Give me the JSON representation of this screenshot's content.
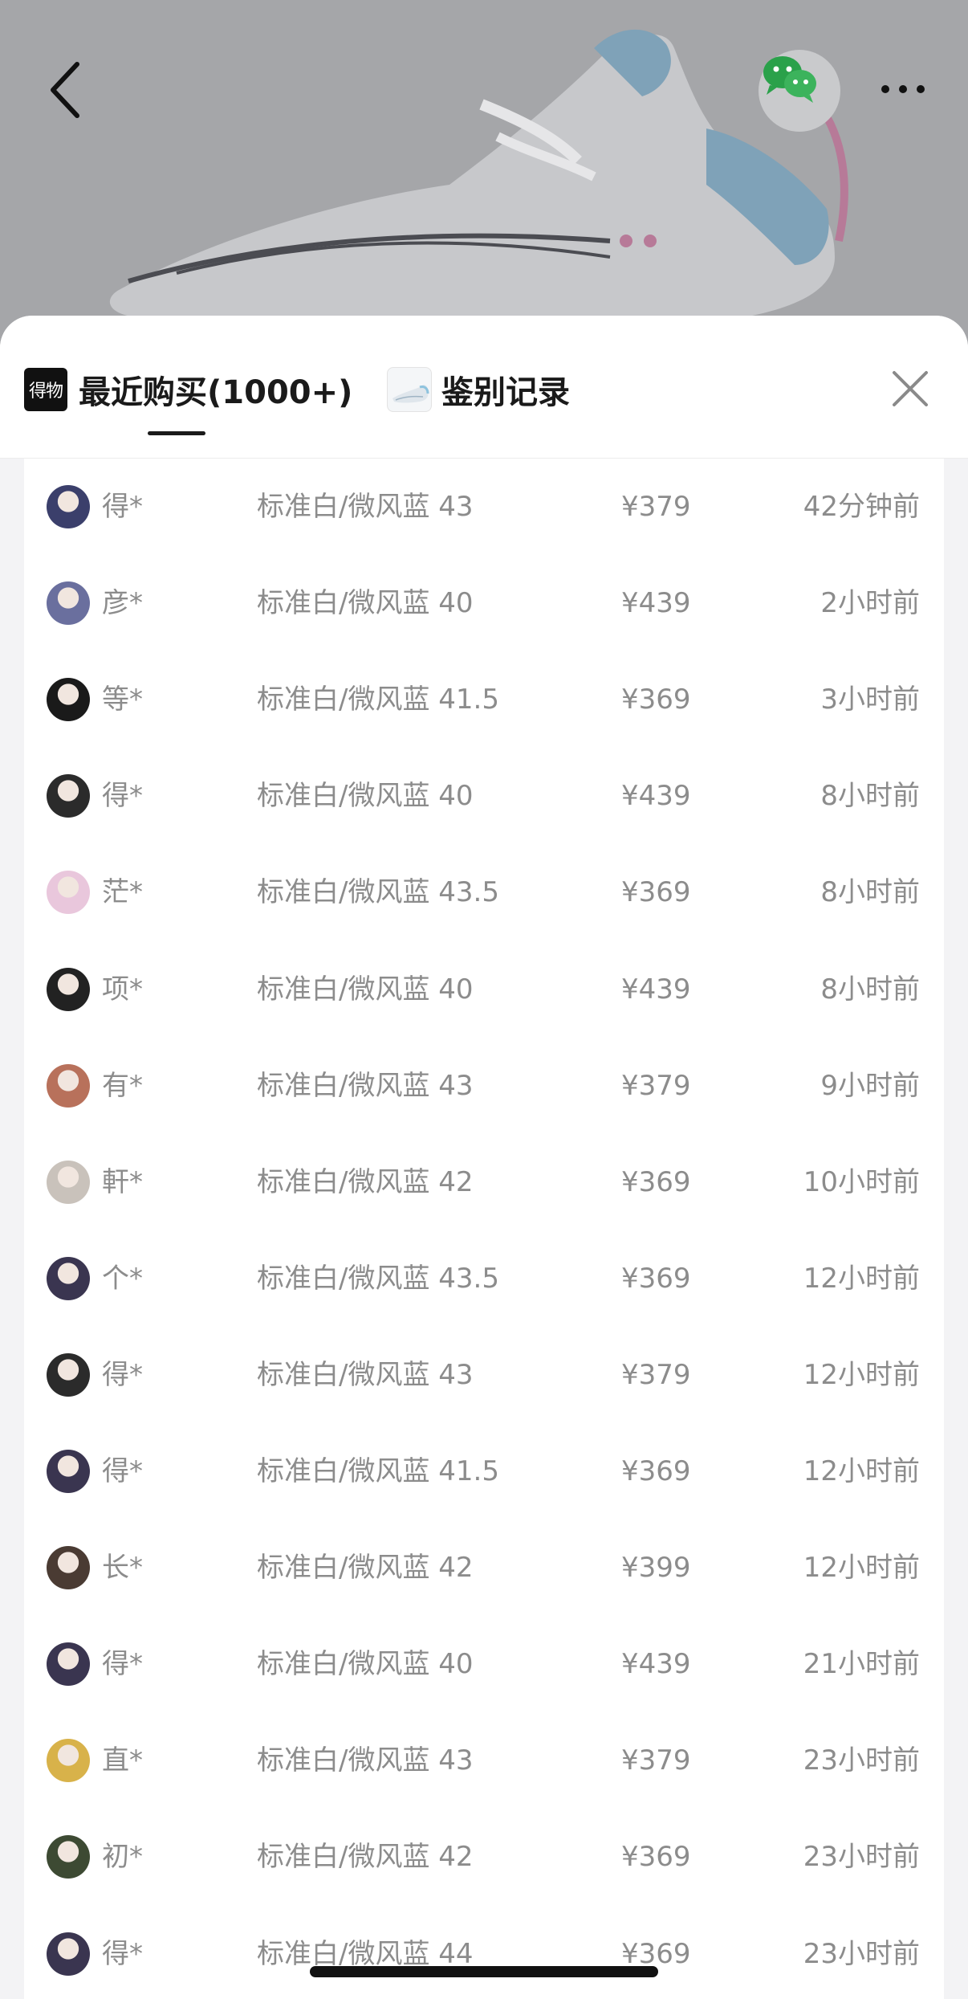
{
  "header": {
    "back_icon": "chevron-left-icon",
    "share_icon": "wechat-icon",
    "more_icon": "more-dots-icon"
  },
  "sheet": {
    "brand_logo": "得物",
    "tabs": [
      {
        "label": "最近购买(1000+)",
        "active": true
      },
      {
        "label": "鉴别记录",
        "active": false
      }
    ],
    "close_icon": "close-icon"
  },
  "purchases": [
    {
      "user": "得*",
      "spec": "标准白/微风蓝 43",
      "price": "¥379",
      "time": "42分钟前",
      "avatar_color": "#3b3f6b"
    },
    {
      "user": "彦*",
      "spec": "标准白/微风蓝 40",
      "price": "¥439",
      "time": "2小时前",
      "avatar_color": "#6a6f9e"
    },
    {
      "user": "等*",
      "spec": "标准白/微风蓝 41.5",
      "price": "¥369",
      "time": "3小时前",
      "avatar_color": "#1a1a1a"
    },
    {
      "user": "得*",
      "spec": "标准白/微风蓝 40",
      "price": "¥439",
      "time": "8小时前",
      "avatar_color": "#2b2b2b"
    },
    {
      "user": "茫*",
      "spec": "标准白/微风蓝 43.5",
      "price": "¥369",
      "time": "8小时前",
      "avatar_color": "#e9c7dc"
    },
    {
      "user": "项*",
      "spec": "标准白/微风蓝 40",
      "price": "¥439",
      "time": "8小时前",
      "avatar_color": "#222222"
    },
    {
      "user": "有*",
      "spec": "标准白/微风蓝 43",
      "price": "¥379",
      "time": "9小时前",
      "avatar_color": "#b8715b"
    },
    {
      "user": "軒*",
      "spec": "标准白/微风蓝 42",
      "price": "¥369",
      "time": "10小时前",
      "avatar_color": "#c9c2bb"
    },
    {
      "user": "个*",
      "spec": "标准白/微风蓝 43.5",
      "price": "¥369",
      "time": "12小时前",
      "avatar_color": "#3a3550"
    },
    {
      "user": "得*",
      "spec": "标准白/微风蓝 43",
      "price": "¥379",
      "time": "12小时前",
      "avatar_color": "#2b2b2b"
    },
    {
      "user": "得*",
      "spec": "标准白/微风蓝 41.5",
      "price": "¥369",
      "time": "12小时前",
      "avatar_color": "#3a3550"
    },
    {
      "user": "长*",
      "spec": "标准白/微风蓝 42",
      "price": "¥399",
      "time": "12小时前",
      "avatar_color": "#4a3b33"
    },
    {
      "user": "得*",
      "spec": "标准白/微风蓝 40",
      "price": "¥439",
      "time": "21小时前",
      "avatar_color": "#3a3550"
    },
    {
      "user": "直*",
      "spec": "标准白/微风蓝 43",
      "price": "¥379",
      "time": "23小时前",
      "avatar_color": "#d8b24a"
    },
    {
      "user": "初*",
      "spec": "标准白/微风蓝 42",
      "price": "¥369",
      "time": "23小时前",
      "avatar_color": "#3d4a33"
    },
    {
      "user": "得*",
      "spec": "标准白/微风蓝 44",
      "price": "¥369",
      "time": "23小时前",
      "avatar_color": "#3a3550"
    }
  ]
}
